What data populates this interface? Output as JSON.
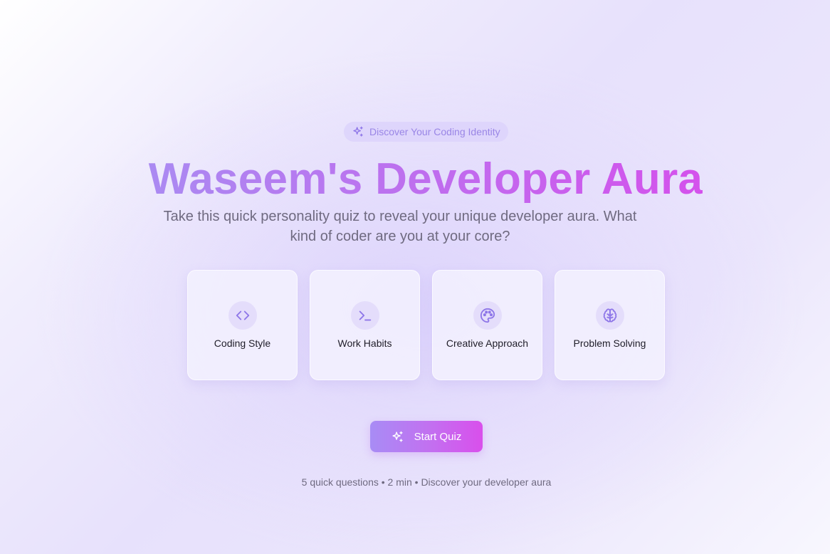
{
  "badge": {
    "icon": "sparkles-icon",
    "text": "Discover Your Coding Identity"
  },
  "hero": {
    "title": "Waseem's Developer Aura",
    "subtitle": "Take this quick personality quiz to reveal your unique developer aura. What kind of coder are you at your core?"
  },
  "categories": [
    {
      "icon": "code-brackets-icon",
      "label": "Coding Style"
    },
    {
      "icon": "terminal-icon",
      "label": "Work Habits"
    },
    {
      "icon": "palette-icon",
      "label": "Creative Approach"
    },
    {
      "icon": "brain-icon",
      "label": "Problem Solving"
    }
  ],
  "cta": {
    "icon": "sparkles-icon",
    "label": "Start Quiz"
  },
  "footnote": "5 quick questions • 2 min • Discover your developer aura",
  "colors": {
    "accent_start": "#a88cf5",
    "accent_end": "#d94fec",
    "icon_color": "#8e76e8",
    "text_muted": "#6f6a80"
  }
}
